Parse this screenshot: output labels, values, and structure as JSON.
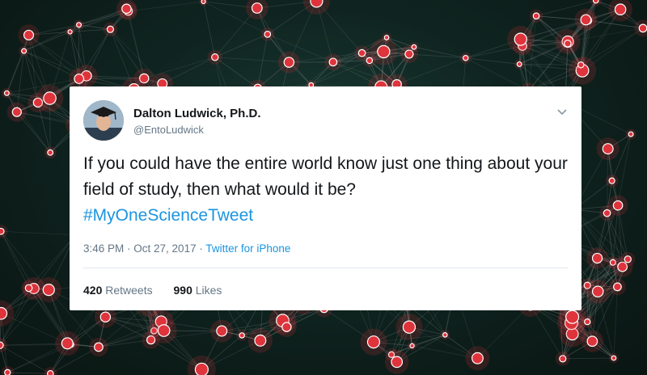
{
  "tweet": {
    "author_name": "Dalton Ludwick, Ph.D.",
    "author_handle": "@EntoLudwick",
    "text": "If you could have the entire world know just one thing about your field of study, then what would it be?",
    "hashtag": "#MyOneScienceTweet",
    "time": "3:46 PM",
    "separator": " · ",
    "date": "Oct 27, 2017",
    "source": "Twitter for iPhone",
    "retweets_count": "420",
    "retweets_label": "Retweets",
    "likes_count": "990",
    "likes_label": "Likes"
  },
  "icons": {
    "menu": "chevron-down-icon",
    "avatar": "graduation-portrait"
  },
  "colors": {
    "link": "#1b95e0",
    "text": "#14171a",
    "muted": "#657786",
    "node": "#e0343c",
    "background": "#0f2420"
  }
}
